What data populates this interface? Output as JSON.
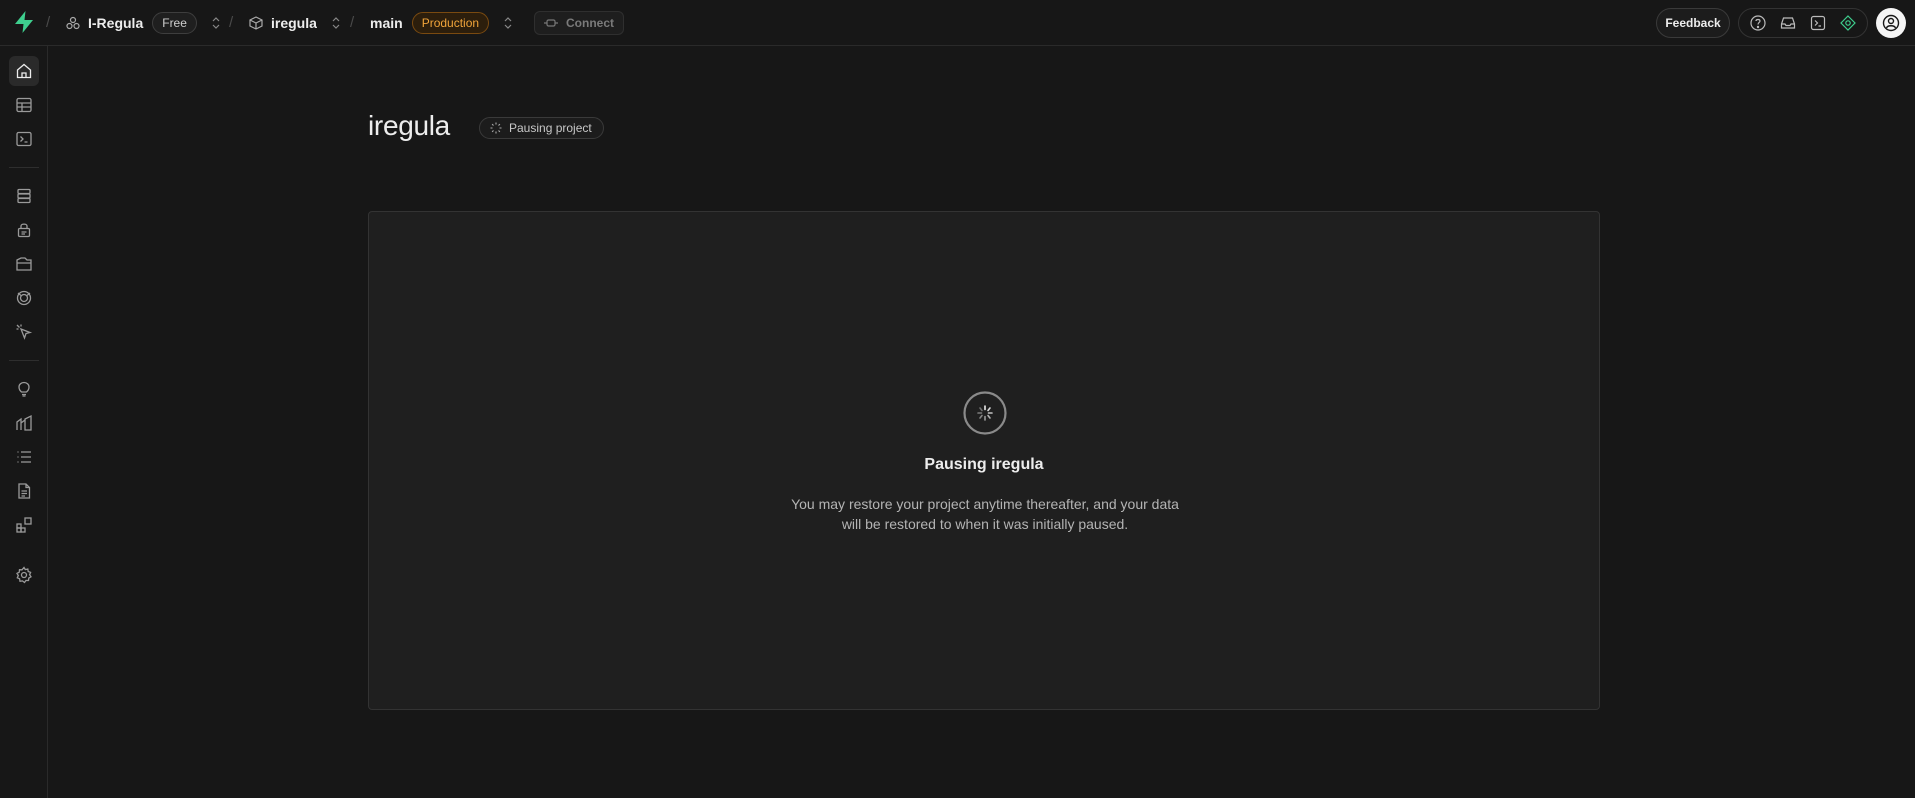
{
  "topbar": {
    "org_name": "I-Regula",
    "org_plan": "Free",
    "project_name": "iregula",
    "branch_name": "main",
    "branch_env": "Production",
    "connect_label": "Connect",
    "feedback_label": "Feedback",
    "icons": [
      "help-icon",
      "inbox-icon",
      "terminal-icon",
      "assistant-icon"
    ]
  },
  "sidebar": {
    "items": [
      "home-icon",
      "table-editor-icon",
      "sql-editor-icon",
      "database-icon",
      "authentication-icon",
      "storage-icon",
      "edge-functions-icon",
      "realtime-icon",
      "advisors-icon",
      "reports-icon",
      "logs-icon",
      "api-docs-icon",
      "integrations-icon",
      "settings-icon"
    ]
  },
  "main": {
    "title": "iregula",
    "status_badge": "Pausing project",
    "panel": {
      "heading": "Pausing iregula",
      "description": "You may restore your project anytime thereafter, and your data will be restored to when it was initially paused."
    }
  },
  "colors": {
    "accent": "#3ecf8e",
    "production": "#f0a43a",
    "background": "#171717"
  }
}
